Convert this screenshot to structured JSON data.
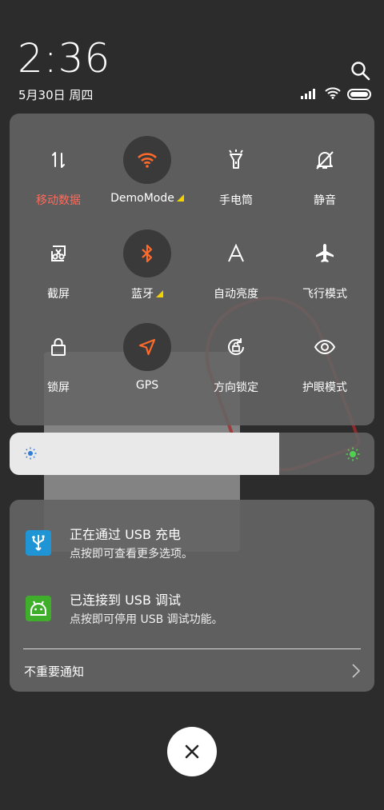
{
  "status_bar": {
    "time": "2:36",
    "date": "5月30日 周四",
    "icons": [
      "signal-icon",
      "wifi-icon",
      "battery-icon"
    ]
  },
  "quick_settings": {
    "tiles": [
      {
        "label": "移动数据",
        "icon": "mobile-data-icon",
        "active": false,
        "label_color": "#ff6a5c"
      },
      {
        "label": "DemoMode",
        "icon": "wifi-icon",
        "active": true,
        "expand": true
      },
      {
        "label": "手电筒",
        "icon": "flashlight-icon",
        "active": false
      },
      {
        "label": "静音",
        "icon": "bell-off-icon",
        "active": false
      },
      {
        "label": "截屏",
        "icon": "screenshot-icon",
        "active": false
      },
      {
        "label": "蓝牙",
        "icon": "bluetooth-icon",
        "active": true,
        "expand": true
      },
      {
        "label": "自动亮度",
        "icon": "auto-brightness-icon",
        "active": false
      },
      {
        "label": "飞行模式",
        "icon": "airplane-icon",
        "active": false
      },
      {
        "label": "锁屏",
        "icon": "lock-icon",
        "active": false
      },
      {
        "label": "GPS",
        "icon": "location-icon",
        "active": true
      },
      {
        "label": "方向锁定",
        "icon": "rotation-lock-icon",
        "active": false
      },
      {
        "label": "护眼模式",
        "icon": "eye-icon",
        "active": false
      }
    ]
  },
  "brightness": {
    "level": 0.74
  },
  "notifications": {
    "items": [
      {
        "title": "正在通过 USB 充电",
        "subtitle": "点按即可查看更多选项。",
        "icon": "usb-icon",
        "color": "#1f95d6"
      },
      {
        "title": "已连接到 USB 调试",
        "subtitle": "点按即可停用 USB 调试功能。",
        "icon": "android-icon",
        "color": "#3fae2a"
      }
    ],
    "footer": "不重要通知"
  },
  "colors": {
    "accent": "#ff6a2a",
    "panel": "#646464"
  }
}
